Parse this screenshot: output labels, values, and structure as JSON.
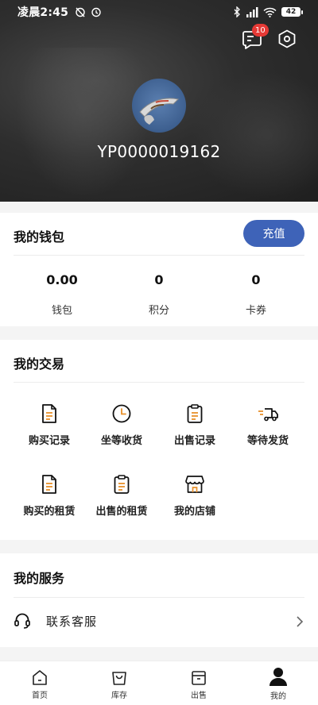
{
  "status_bar": {
    "time": "凌晨2:45",
    "battery": "42"
  },
  "header": {
    "message_badge": "10",
    "user_id": "YP0000019162"
  },
  "wallet": {
    "title": "我的钱包",
    "recharge_label": "充值",
    "stats": [
      {
        "value": "0.00",
        "label": "钱包"
      },
      {
        "value": "0",
        "label": "积分"
      },
      {
        "value": "0",
        "label": "卡券"
      }
    ]
  },
  "trade": {
    "title": "我的交易",
    "items": [
      {
        "label": "购买记录",
        "icon": "purchase-record-icon"
      },
      {
        "label": "坐等收货",
        "icon": "clock-icon"
      },
      {
        "label": "出售记录",
        "icon": "sale-record-icon"
      },
      {
        "label": "等待发货",
        "icon": "delivery-truck-icon"
      },
      {
        "label": "购买的租赁",
        "icon": "rent-purchase-icon"
      },
      {
        "label": "出售的租赁",
        "icon": "rent-sale-icon"
      },
      {
        "label": "我的店铺",
        "icon": "store-icon"
      }
    ]
  },
  "service": {
    "title": "我的服务",
    "items": [
      {
        "label": "联系客服",
        "icon": "headset-icon"
      }
    ]
  },
  "nav": {
    "items": [
      {
        "label": "首页",
        "icon": "home-icon"
      },
      {
        "label": "库存",
        "icon": "bag-icon"
      },
      {
        "label": "出售",
        "icon": "box-icon"
      },
      {
        "label": "我的",
        "icon": "user-icon",
        "active": true
      }
    ]
  },
  "colors": {
    "accent": "#3e63b8",
    "badge": "#e53935",
    "icon_orange": "#e8902a"
  }
}
